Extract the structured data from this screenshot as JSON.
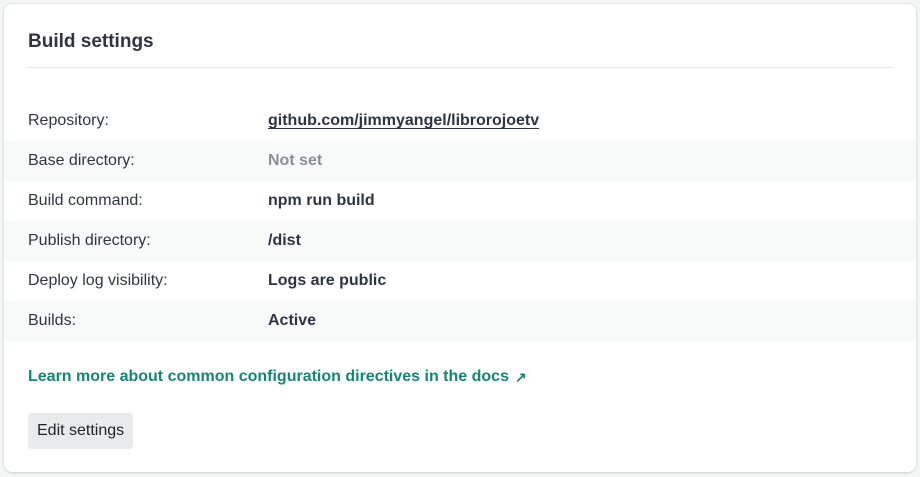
{
  "card": {
    "title": "Build settings"
  },
  "settings": [
    {
      "label": "Repository:",
      "value": "github.com/jimmyangel/librorojoetv"
    },
    {
      "label": "Base directory:",
      "value": "Not set"
    },
    {
      "label": "Build command:",
      "value": "npm run build"
    },
    {
      "label": "Publish directory:",
      "value": "/dist"
    },
    {
      "label": "Deploy log visibility:",
      "value": "Logs are public"
    },
    {
      "label": "Builds:",
      "value": "Active"
    }
  ],
  "docs_link": {
    "label": "Learn more about common configuration directives in the docs",
    "icon": "external-arrow-icon"
  },
  "actions": {
    "edit_label": "Edit settings"
  },
  "colors": {
    "link_accent": "#138774",
    "muted": "#8a8f94"
  }
}
